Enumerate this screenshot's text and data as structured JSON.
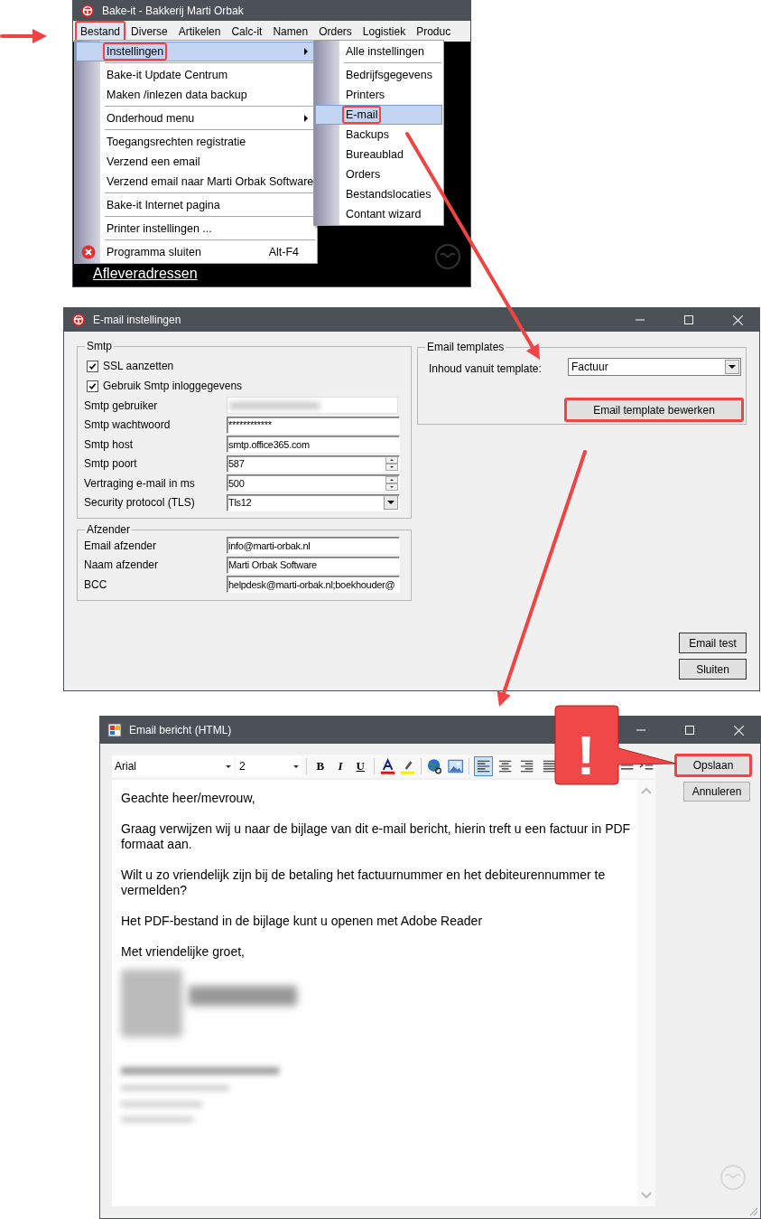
{
  "main_window": {
    "title": "Bake-it - Bakkerij Marti Orbak",
    "menu": [
      {
        "label": "Bestand",
        "selected": true,
        "highlighted": true
      },
      {
        "label": "Diverse",
        "selected": false,
        "highlighted": false
      },
      {
        "label": "Artikelen",
        "selected": false,
        "highlighted": false
      },
      {
        "label": "Calc-it",
        "selected": false,
        "highlighted": false
      },
      {
        "label": "Namen",
        "selected": false,
        "highlighted": false
      },
      {
        "label": "Orders",
        "selected": false,
        "highlighted": false
      },
      {
        "label": "Logistiek",
        "selected": false,
        "highlighted": false
      },
      {
        "label": "Produc",
        "selected": false,
        "highlighted": false
      }
    ],
    "dropdown": [
      [
        {
          "label": "Instellingen",
          "kind": "submenu",
          "selected": true,
          "highlighted": true
        }
      ],
      [
        {
          "label": "Bake-it Update Centrum",
          "kind": "item",
          "selected": false,
          "highlighted": false
        },
        {
          "label": "Maken /inlezen data backup",
          "kind": "item",
          "selected": false,
          "highlighted": false
        }
      ],
      [
        {
          "label": "Onderhoud menu",
          "kind": "submenu",
          "selected": false,
          "highlighted": false
        }
      ],
      [
        {
          "label": "Toegangsrechten registratie",
          "kind": "item",
          "selected": false,
          "highlighted": false
        },
        {
          "label": "Verzend een email",
          "kind": "item",
          "selected": false,
          "highlighted": false
        },
        {
          "label": "Verzend email naar Marti Orbak Software",
          "kind": "item",
          "selected": false,
          "highlighted": false
        }
      ],
      [
        {
          "label": "Bake-it Internet pagina",
          "kind": "item",
          "selected": false,
          "highlighted": false
        }
      ],
      [
        {
          "label": "Printer instellingen ...",
          "kind": "item",
          "selected": false,
          "highlighted": false
        }
      ],
      [
        {
          "label": "Programma sluiten",
          "kind": "exit",
          "shortcut": "Alt-F4",
          "selected": false,
          "highlighted": false
        }
      ]
    ],
    "submenu": [
      [
        {
          "label": "Alle instellingen",
          "selected": false,
          "highlighted": false
        }
      ],
      [
        {
          "label": "Bedrijfsgegevens",
          "selected": false,
          "highlighted": false
        },
        {
          "label": "Printers",
          "selected": false,
          "highlighted": false
        },
        {
          "label": "E-mail",
          "selected": true,
          "highlighted": true
        },
        {
          "label": "Backups",
          "selected": false,
          "highlighted": false
        },
        {
          "label": "Bureaublad",
          "selected": false,
          "highlighted": false
        },
        {
          "label": "Orders",
          "selected": false,
          "highlighted": false
        },
        {
          "label": "Bestandslocaties",
          "selected": false,
          "highlighted": false
        },
        {
          "label": "Contant wizard",
          "selected": false,
          "highlighted": false
        }
      ]
    ],
    "background_link": "Afleveradressen"
  },
  "settings_dialog": {
    "title": "E-mail instellingen",
    "smtp": {
      "legend": "Smtp",
      "checkboxes": [
        {
          "label": "SSL aanzetten",
          "checked": true
        },
        {
          "label": "Gebruik Smtp inloggegevens",
          "checked": true
        }
      ],
      "fields": [
        {
          "label": "Smtp gebruiker",
          "kind": "blurred"
        },
        {
          "label": "Smtp wachtwoord",
          "kind": "text",
          "value": "************"
        },
        {
          "label": "Smtp host",
          "kind": "text",
          "value": "smtp.office365.com"
        },
        {
          "label": "Smtp poort",
          "kind": "spin",
          "value": "587"
        },
        {
          "label": "Vertraging e-mail in ms",
          "kind": "spin",
          "value": "500"
        },
        {
          "label": "Security protocol (TLS)",
          "kind": "combo",
          "value": "Tls12"
        }
      ]
    },
    "sender": {
      "legend": "Afzender",
      "fields": [
        {
          "label": "Email afzender",
          "kind": "text",
          "value": "info@marti-orbak.nl"
        },
        {
          "label": "Naam afzender",
          "kind": "text",
          "value": "Marti Orbak Software"
        },
        {
          "label": "BCC",
          "kind": "text",
          "value": "helpdesk@marti-orbak.nl;boekhouder@"
        }
      ]
    },
    "templates": {
      "legend": "Email templates",
      "label": "Inhoud vanuit template:",
      "value": "Factuur",
      "button": {
        "label": "Email template bewerken",
        "highlighted": true
      }
    },
    "buttons": [
      {
        "label": "Email test",
        "highlighted": false
      },
      {
        "label": "Sluiten",
        "highlighted": false
      }
    ]
  },
  "editor_window": {
    "title": "Email bericht (HTML)",
    "font": "Arial",
    "size": "2",
    "format_buttons": [
      {
        "label": "B",
        "kind": "bold"
      },
      {
        "label": "I",
        "kind": "italic"
      },
      {
        "label": "U",
        "kind": "underline"
      }
    ],
    "alignments": [
      {
        "selected": true
      },
      {
        "selected": false
      },
      {
        "selected": false
      },
      {
        "selected": false
      }
    ],
    "paragraphs": [
      "Geachte heer/mevrouw,",
      "Graag verwijzen wij u naar de bijlage van dit e-mail bericht, hierin treft u een factuur in PDF formaat aan.",
      "Wilt u zo vriendelijk zijn bij de betaling het factuurnummer en het debiteurennummer te vermelden?",
      "Het PDF-bestand in de bijlage kunt u openen met Adobe Reader",
      "Met vriendelijke groet,"
    ],
    "buttons": [
      {
        "label": "Opslaan",
        "highlighted": true
      },
      {
        "label": "Annuleren",
        "highlighted": false
      }
    ]
  },
  "callout": "!"
}
